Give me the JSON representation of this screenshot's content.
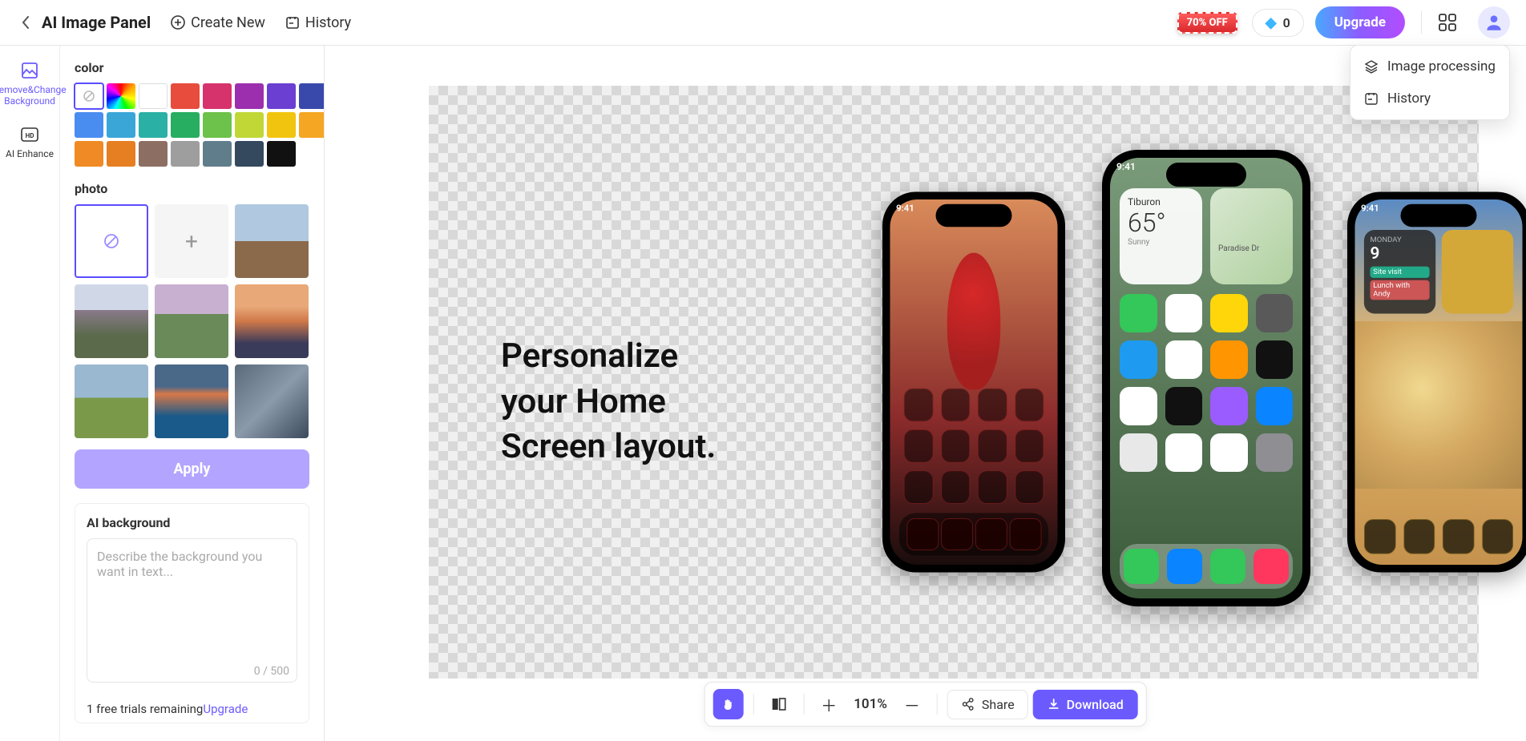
{
  "topbar": {
    "title": "AI Image Panel",
    "create": "Create New",
    "history": "History",
    "promo": "70% OFF",
    "credits": "0",
    "upgrade": "Upgrade"
  },
  "popover": {
    "processing": "Image processing",
    "history": "History"
  },
  "rail": {
    "remove": "Remove&Change Background",
    "enhance": "AI Enhance"
  },
  "panel": {
    "color_label": "color",
    "photo_label": "photo",
    "apply": "Apply",
    "ai_label": "AI background",
    "ai_placeholder": "Describe the background you want in text...",
    "counter": "0 / 500",
    "trials_prefix": "1 free trials remaining",
    "trials_link": "Upgrade"
  },
  "canvas": {
    "hero1": "Personalize",
    "hero2": "your Home",
    "hero3": "Screen layout.",
    "weather_city": "Tiburon",
    "weather_temp": "65°",
    "weather_cond": "Sunny",
    "map_label": "Paradise Dr",
    "p3_day": "MONDAY",
    "p3_date": "9",
    "p3_ev1": "Site visit",
    "p3_ev2": "Lunch with Andy",
    "time": "9:41"
  },
  "btm": {
    "zoom": "101%",
    "share": "Share",
    "download": "Download"
  },
  "colors": {
    "swatches": [
      "#e74c3c",
      "#d6336c",
      "#9b2fae",
      "#6a3fd1",
      "#3949ab",
      "#4a8df0",
      "#3aa6d8",
      "#2bb0a6",
      "#27ae60",
      "#6cc24a",
      "#c0d736",
      "#f1c40f",
      "#f5a623",
      "#f08a24",
      "#e67e22",
      "#d35400",
      "#8d6e63",
      "#9e9e9e",
      "#607d8b",
      "#34495e",
      "#111111"
    ]
  }
}
